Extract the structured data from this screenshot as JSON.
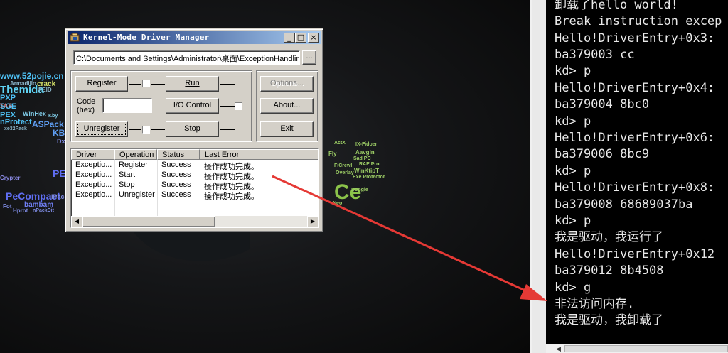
{
  "desktop": {
    "wallpaper_words": [
      "www.52pojie.cn",
      "Armadillo",
      "crack",
      "Themida",
      "PEID",
      "PXP",
      "TAS",
      "SGE",
      "PEX",
      "WinHex",
      "Kby",
      "nProtect",
      "xe32Pack",
      "ASPack",
      "KB",
      "Dxy",
      "PE",
      "PeCompact",
      "Crypter",
      "bambam",
      "iPack",
      "Fot",
      "Hprot",
      "nPackDit",
      "Aavgin",
      "WinKtipT",
      "Sad PC",
      "IX-Fidoer",
      "ActX",
      "Ce",
      "Dongle",
      "FiCrewl",
      "Fly",
      "RAE Prot",
      "Exe Protector",
      "Overlay",
      "Neo"
    ]
  },
  "window": {
    "title": "Kernel-Mode Driver Manager",
    "caption_buttons": {
      "minimize": "_",
      "maximize": "□",
      "close": "×"
    },
    "path_value": "C:\\Documents and Settings\\Administrator\\桌面\\ExceptionHandlin",
    "browse_label": "...",
    "buttons": {
      "register": "Register",
      "run": "Run",
      "io_control": "I/O Control",
      "unregister": "Unregister",
      "stop": "Stop",
      "options": "Options...",
      "about": "About...",
      "exit": "Exit"
    },
    "code_label_1": "Code",
    "code_label_2": "(hex)",
    "code_value": "",
    "list": {
      "columns": [
        "Driver",
        "Operation",
        "Status",
        "Last Error"
      ],
      "rows": [
        [
          "Exceptio...",
          "Register",
          "Success",
          "操作成功完成。"
        ],
        [
          "Exceptio...",
          "Start",
          "Success",
          "操作成功完成。"
        ],
        [
          "Exceptio...",
          "Stop",
          "Success",
          "操作成功完成。"
        ],
        [
          "Exceptio...",
          "Unregister",
          "Success",
          "操作成功完成。"
        ]
      ]
    }
  },
  "console": {
    "lines": [
      "卸载了hello world!",
      "Break instruction excep",
      "Hello!DriverEntry+0x3:",
      "ba379003 cc",
      "kd> p",
      "Hello!DriverEntry+0x4:",
      "ba379004 8bc0",
      "kd> p",
      "Hello!DriverEntry+0x6:",
      "ba379006 8bc9",
      "kd> p",
      "Hello!DriverEntry+0x8:",
      "ba379008 68689037ba",
      "kd> p",
      "我是驱动，我运行了",
      "Hello!DriverEntry+0x12",
      "ba379012 8b4508",
      "kd> g",
      "非法访问内存.",
      "我是驱动，我卸载了"
    ],
    "scroll_left": "◀"
  },
  "colors": {
    "annotation_arrow": "#e53935",
    "titlebar_start": "#0a246a",
    "titlebar_end": "#a6caf0",
    "dialog_face": "#d4d0c8",
    "console_bg": "#000000",
    "console_text": "#e8e8e8"
  }
}
